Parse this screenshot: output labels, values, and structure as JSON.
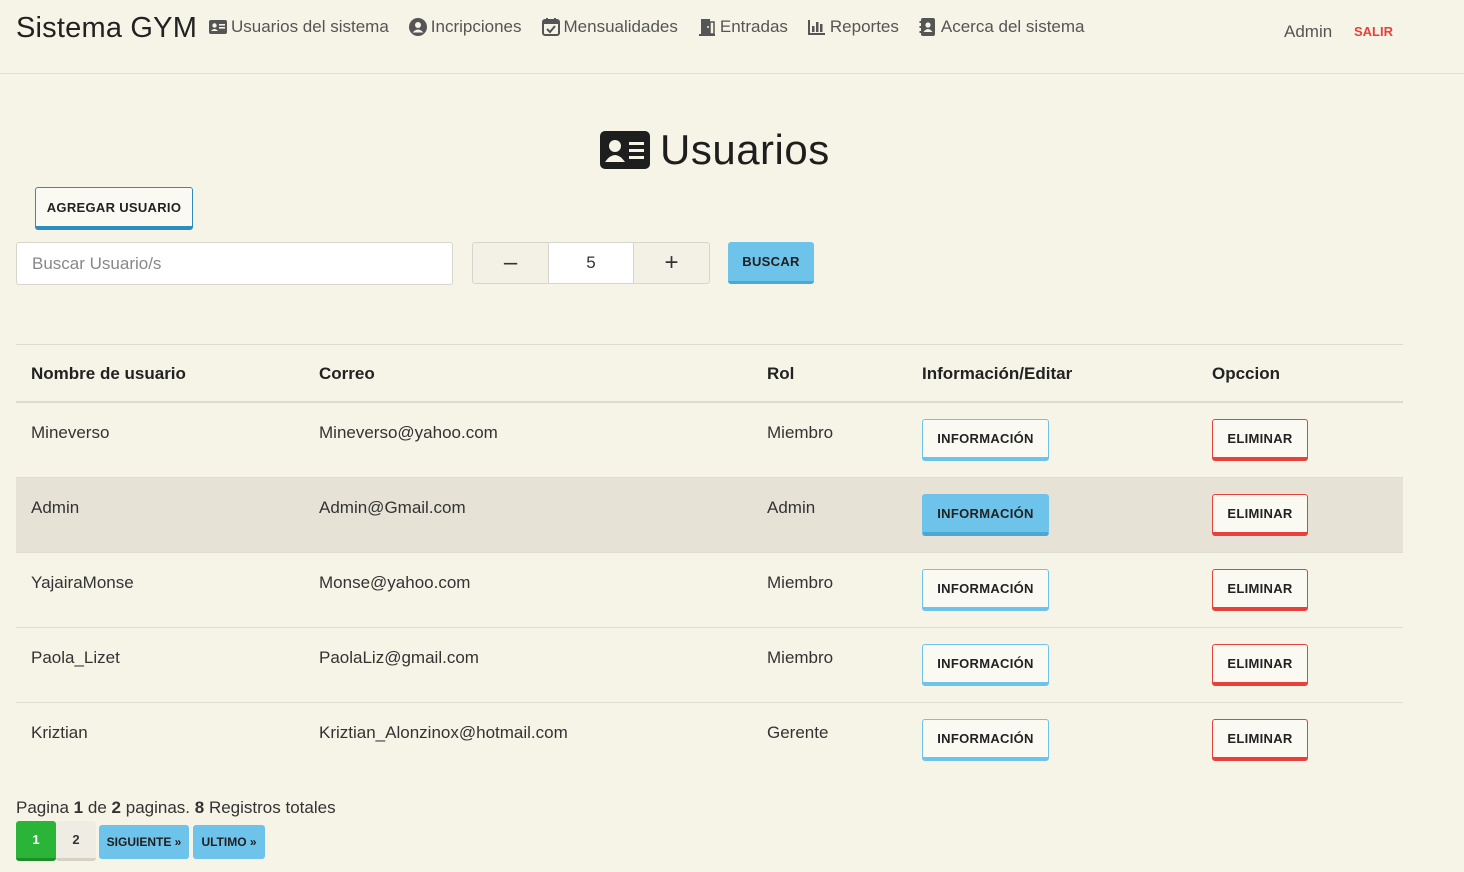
{
  "navbar": {
    "brand": "Sistema GYM",
    "items": [
      {
        "label": "Usuarios del sistema",
        "icon": "id-card-icon"
      },
      {
        "label": "Incripciones",
        "icon": "user-circle-icon"
      },
      {
        "label": "Mensualidades",
        "icon": "calendar-check-icon"
      },
      {
        "label": "Entradas",
        "icon": "door-icon"
      },
      {
        "label": "Reportes",
        "icon": "bar-chart-icon"
      },
      {
        "label": "Acerca del sistema",
        "icon": "address-book-icon"
      }
    ],
    "user": "Admin",
    "logout": "SALIR"
  },
  "page": {
    "title": "Usuarios",
    "title_icon": "id-card-icon",
    "add_button": "AGREGAR USUARIO"
  },
  "search": {
    "placeholder": "Buscar Usuario/s",
    "value": "",
    "stepper_minus": "–",
    "stepper_value": "5",
    "stepper_plus": "+",
    "button": "BUSCAR"
  },
  "table": {
    "headers": [
      "Nombre de usuario",
      "Correo",
      "Rol",
      "Información/Editar",
      "Opccion"
    ],
    "rows": [
      {
        "name": "Mineverso",
        "email": "Mineverso@yahoo.com",
        "role": "Miembro",
        "info": "INFORMACIÓN",
        "delete": "ELIMINAR"
      },
      {
        "name": "Admin",
        "email": "Admin@Gmail.com",
        "role": "Admin",
        "info": "INFORMACIÓN",
        "delete": "ELIMINAR"
      },
      {
        "name": "YajairaMonse",
        "email": "Monse@yahoo.com",
        "role": "Miembro",
        "info": "INFORMACIÓN",
        "delete": "ELIMINAR"
      },
      {
        "name": "Paola_Lizet",
        "email": "PaolaLiz@gmail.com",
        "role": "Miembro",
        "info": "INFORMACIÓN",
        "delete": "ELIMINAR"
      },
      {
        "name": "Kriztian",
        "email": "Kriztian_Alonzinox@hotmail.com",
        "role": "Gerente",
        "info": "INFORMACIÓN",
        "delete": "ELIMINAR"
      }
    ]
  },
  "pagination": {
    "prefix": "Pagina",
    "current": "1",
    "of": "de",
    "total_pages": "2",
    "pages_word": "paginas.",
    "total_records": "8",
    "records_word": "Registros totales",
    "pages": [
      "1",
      "2"
    ],
    "next": "SIGUIENTE »",
    "last": "ULTIMO »"
  },
  "colors": {
    "background": "#f6f4e6",
    "info": "#6ec3ea",
    "danger": "#e8403a",
    "primary_border": "#2d8cc0",
    "active_page": "#2bb538"
  }
}
